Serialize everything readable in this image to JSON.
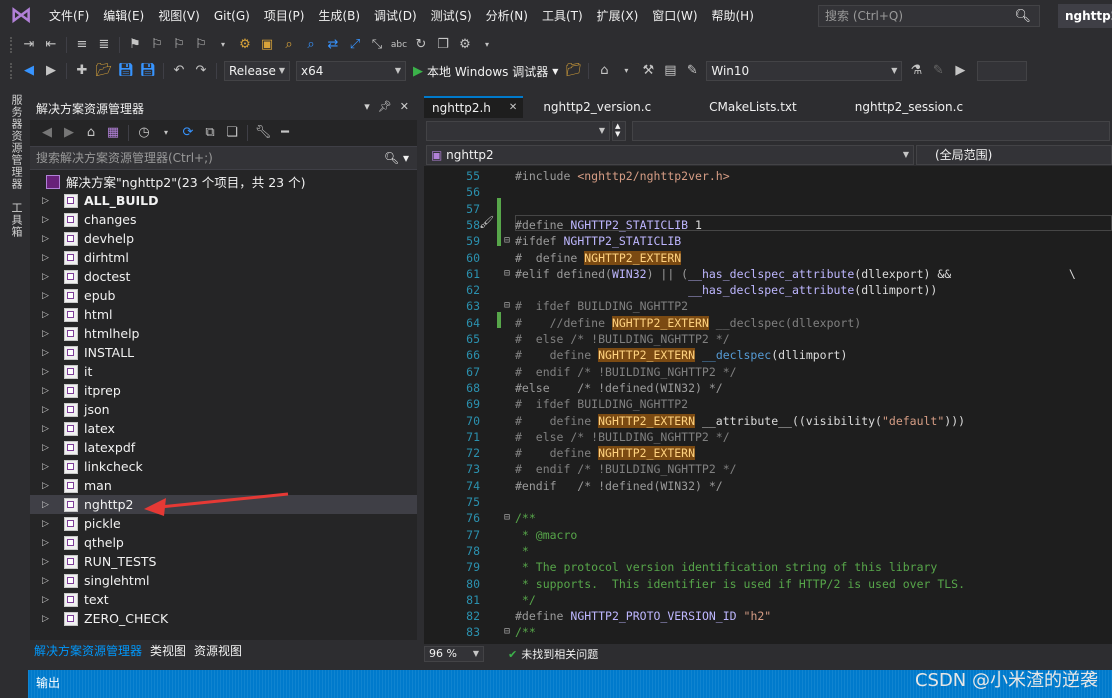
{
  "menubar": {
    "items": [
      "文件(F)",
      "编辑(E)",
      "视图(V)",
      "Git(G)",
      "项目(P)",
      "生成(B)",
      "调试(D)",
      "测试(S)",
      "分析(N)",
      "工具(T)",
      "扩展(X)",
      "窗口(W)",
      "帮助(H)"
    ],
    "search_placeholder": "搜索 (Ctrl+Q)",
    "project_title": "nghttp2"
  },
  "toolbar": {
    "config": "Release",
    "platform": "x64",
    "run_label": "本地 Windows 调试器",
    "target": "Win10"
  },
  "side_tabs": [
    "服务器资源管理器",
    "工具箱"
  ],
  "solution_explorer": {
    "title": "解决方案资源管理器",
    "search_placeholder": "搜索解决方案资源管理器(Ctrl+;)",
    "solution_label": "解决方案\"nghttp2\"(23 个项目，共 23 个)",
    "items": [
      {
        "label": "ALL_BUILD",
        "bold": true
      },
      {
        "label": "changes"
      },
      {
        "label": "devhelp"
      },
      {
        "label": "dirhtml"
      },
      {
        "label": "doctest"
      },
      {
        "label": "epub"
      },
      {
        "label": "html"
      },
      {
        "label": "htmlhelp"
      },
      {
        "label": "INSTALL"
      },
      {
        "label": "it"
      },
      {
        "label": "itprep"
      },
      {
        "label": "json"
      },
      {
        "label": "latex"
      },
      {
        "label": "latexpdf"
      },
      {
        "label": "linkcheck"
      },
      {
        "label": "man"
      },
      {
        "label": "nghttp2",
        "selected": true
      },
      {
        "label": "pickle"
      },
      {
        "label": "qthelp"
      },
      {
        "label": "RUN_TESTS"
      },
      {
        "label": "singlehtml"
      },
      {
        "label": "text"
      },
      {
        "label": "ZERO_CHECK"
      }
    ],
    "bottom_tabs": [
      "解决方案资源管理器",
      "类视图",
      "资源视图"
    ]
  },
  "editor": {
    "tabs": [
      "nghttp2.h",
      "nghttp2_version.c",
      "CMakeLists.txt",
      "nghttp2_session.c"
    ],
    "nav_left": "nghttp2",
    "nav_right": "(全局范围)",
    "zoom": "96 %",
    "status": "未找到相关问题",
    "lines": [
      {
        "n": "55",
        "html": "<span class='pp'>#include</span> <span class='inc'>&lt;nghttp2/nghttp2ver.h&gt;</span>"
      },
      {
        "n": "56",
        "html": ""
      },
      {
        "n": "57",
        "html": ""
      },
      {
        "n": "58",
        "html": "<span class='pp'>#define</span> <span class='mac'>NGHTTP2_STATICLIB</span> 1"
      },
      {
        "n": "59",
        "html": "<span class='pp'>#ifdef</span> <span class='mac'>NGHTTP2_STATICLIB</span>"
      },
      {
        "n": "60",
        "html": "<span class='pp'>#  define</span> <span class='hl'>NGHTTP2_EXTERN</span>"
      },
      {
        "n": "61",
        "html": "<span class='pp'>#elif defined(</span><span class='mac'>WIN32</span><span class='pp'>) || (</span><span class='mac'>__has_declspec_attribute</span>(dllexport) &amp;&amp;                 \\"
      },
      {
        "n": "62",
        "html": "                         <span class='mac'>__has_declspec_attribute</span>(dllimport))"
      },
      {
        "n": "63",
        "html": "<span class='gray'>#  ifdef BUILDING_NGHTTP2</span>"
      },
      {
        "n": "64",
        "html": "<span class='gray'>#    //define </span><span class='hl'>NGHTTP2_EXTERN</span><span class='gray'> __declspec(dllexport)</span>"
      },
      {
        "n": "65",
        "html": "<span class='gray'>#  else /* !BUILDING_NGHTTP2 */</span>"
      },
      {
        "n": "66",
        "html": "<span class='gray'>#    define </span><span class='hl'>NGHTTP2_EXTERN</span> <span class='key'>__declspec</span>(dllimport)"
      },
      {
        "n": "67",
        "html": "<span class='gray'>#  endif /* !BUILDING_NGHTTP2 */</span>"
      },
      {
        "n": "68",
        "html": "<span class='pp'>#else    /* !defined(WIN32) */</span>"
      },
      {
        "n": "69",
        "html": "<span class='gray'>#  ifdef BUILDING_NGHTTP2</span>"
      },
      {
        "n": "70",
        "html": "<span class='gray'>#    define </span><span class='hl'>NGHTTP2_EXTERN</span> __attribute__((visibility(<span class='str'>\"default\"</span>)))"
      },
      {
        "n": "71",
        "html": "<span class='gray'>#  else /* !BUILDING_NGHTTP2 */</span>"
      },
      {
        "n": "72",
        "html": "<span class='gray'>#    define </span><span class='hl'>NGHTTP2_EXTERN</span>"
      },
      {
        "n": "73",
        "html": "<span class='gray'>#  endif /* !BUILDING_NGHTTP2 */</span>"
      },
      {
        "n": "74",
        "html": "<span class='pp'>#endif   /* !defined(WIN32) */</span>"
      },
      {
        "n": "75",
        "html": ""
      },
      {
        "n": "76",
        "html": "<span class='cmt'>/**</span>"
      },
      {
        "n": "77",
        "html": "<span class='cmt'> * @macro</span>"
      },
      {
        "n": "78",
        "html": "<span class='cmt'> *</span>"
      },
      {
        "n": "79",
        "html": "<span class='cmt'> * The protocol version identification string of this library</span>"
      },
      {
        "n": "80",
        "html": "<span class='cmt'> * supports.  This identifier is used if HTTP/2 is used over TLS.</span>"
      },
      {
        "n": "81",
        "html": "<span class='cmt'> */</span>"
      },
      {
        "n": "82",
        "html": "<span class='pp'>#define</span> <span class='mac'>NGHTTP2_PROTO_VERSION_ID</span> <span class='str'>\"h2\"</span>"
      },
      {
        "n": "83",
        "html": "<span class='cmt'>/**</span>"
      }
    ]
  },
  "output": {
    "title": "输出"
  },
  "watermark": "CSDN @小米渣的逆袭"
}
